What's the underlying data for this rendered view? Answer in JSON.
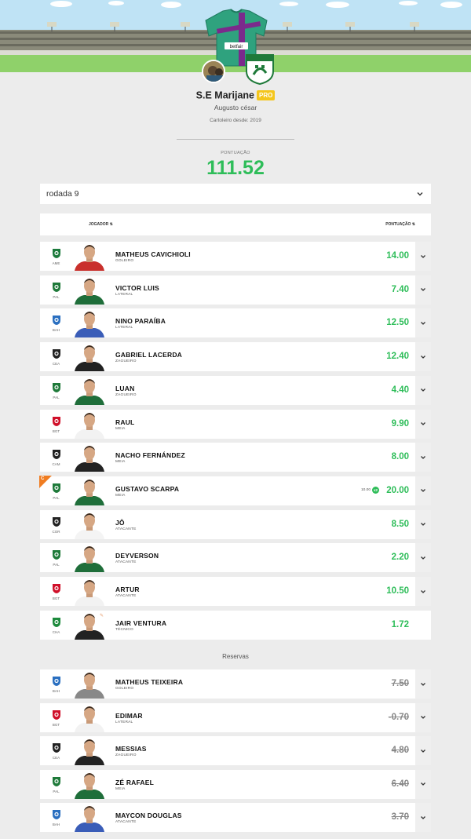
{
  "team": {
    "name": "S.E Marijane",
    "pro_badge": "PRO",
    "owner": "Augusto césar",
    "since": "Cartoleiro desde: 2019",
    "jersey_sponsor": "betfair"
  },
  "score": {
    "label": "PONTUAÇÃO",
    "total": "111.52"
  },
  "round_selector": {
    "value": "rodada 9"
  },
  "table_header": {
    "player": "JOGADOR ⇅",
    "points": "PONTUAÇÃO ⇅"
  },
  "colors": {
    "accent_green": "#2ebd59",
    "captain_orange": "#f07d22",
    "pro_yellow": "#f4c61c"
  },
  "starters": [
    {
      "club": "AME",
      "name": "MATHEUS CAVICHIOLI",
      "position": "GOLEIRO",
      "points": "14.00",
      "club_color": "#1c7a3c",
      "kit": "#c9302c"
    },
    {
      "club": "PAL",
      "name": "VICTOR LUIS",
      "position": "LATERAL",
      "points": "7.40",
      "club_color": "#1f7a3a",
      "kit": "#1f6e3a"
    },
    {
      "club": "BAH",
      "name": "NINO PARAÍBA",
      "position": "LATERAL",
      "points": "12.50",
      "club_color": "#2a6fc0",
      "kit": "#3a5db8"
    },
    {
      "club": "CEA",
      "name": "GABRIEL LACERDA",
      "position": "ZAGUEIRO",
      "points": "12.40",
      "club_color": "#222222",
      "kit": "#222222"
    },
    {
      "club": "PAL",
      "name": "LUAN",
      "position": "ZAGUEIRO",
      "points": "4.40",
      "club_color": "#1f7a3a",
      "kit": "#1f6e3a"
    },
    {
      "club": "BGT",
      "name": "RAUL",
      "position": "MEIA",
      "points": "9.90",
      "club_color": "#d0102a",
      "kit": "#f2f2f2"
    },
    {
      "club": "CAM",
      "name": "NACHO FERNÁNDEZ",
      "position": "MEIA",
      "points": "8.00",
      "club_color": "#222222",
      "kit": "#222222"
    },
    {
      "club": "PAL",
      "name": "GUSTAVO SCARPA",
      "position": "MEIA",
      "points": "20.00",
      "club_color": "#1f7a3a",
      "kit": "#1f6e3a",
      "captain": "C",
      "original_points": "10.00",
      "multiplier": "x2"
    },
    {
      "club": "COR",
      "name": "JÔ",
      "position": "ATACANTE",
      "points": "8.50",
      "club_color": "#222222",
      "kit": "#f4f4f4"
    },
    {
      "club": "PAL",
      "name": "DEYVERSON",
      "position": "ATACANTE",
      "points": "2.20",
      "club_color": "#1f7a3a",
      "kit": "#1f6e3a"
    },
    {
      "club": "BGT",
      "name": "ARTUR",
      "position": "ATACANTE",
      "points": "10.50",
      "club_color": "#d0102a",
      "kit": "#f2f2f2"
    },
    {
      "club": "CHA",
      "name": "JAIR VENTURA",
      "position": "TÉCNICO",
      "points": "1.72",
      "club_color": "#1c8a3c",
      "kit": "#222222",
      "coach": true
    }
  ],
  "reserves_title": "Reservas",
  "reserves": [
    {
      "club": "BAH",
      "name": "MATHEUS TEIXEIRA",
      "position": "GOLEIRO",
      "points": "7.50",
      "club_color": "#2a6fc0",
      "kit": "#888888"
    },
    {
      "club": "BGT",
      "name": "EDIMAR",
      "position": "LATERAL",
      "points": "-0.70",
      "club_color": "#d0102a",
      "kit": "#f2f2f2"
    },
    {
      "club": "CEA",
      "name": "MESSIAS",
      "position": "ZAGUEIRO",
      "points": "4.80",
      "club_color": "#222222",
      "kit": "#222222"
    },
    {
      "club": "PAL",
      "name": "ZÉ RAFAEL",
      "position": "MEIA",
      "points": "6.40",
      "club_color": "#1f7a3a",
      "kit": "#1f6e3a"
    },
    {
      "club": "BAH",
      "name": "MAYCON DOUGLAS",
      "position": "ATACANTE",
      "points": "3.70",
      "club_color": "#2a6fc0",
      "kit": "#3a5db8"
    }
  ]
}
